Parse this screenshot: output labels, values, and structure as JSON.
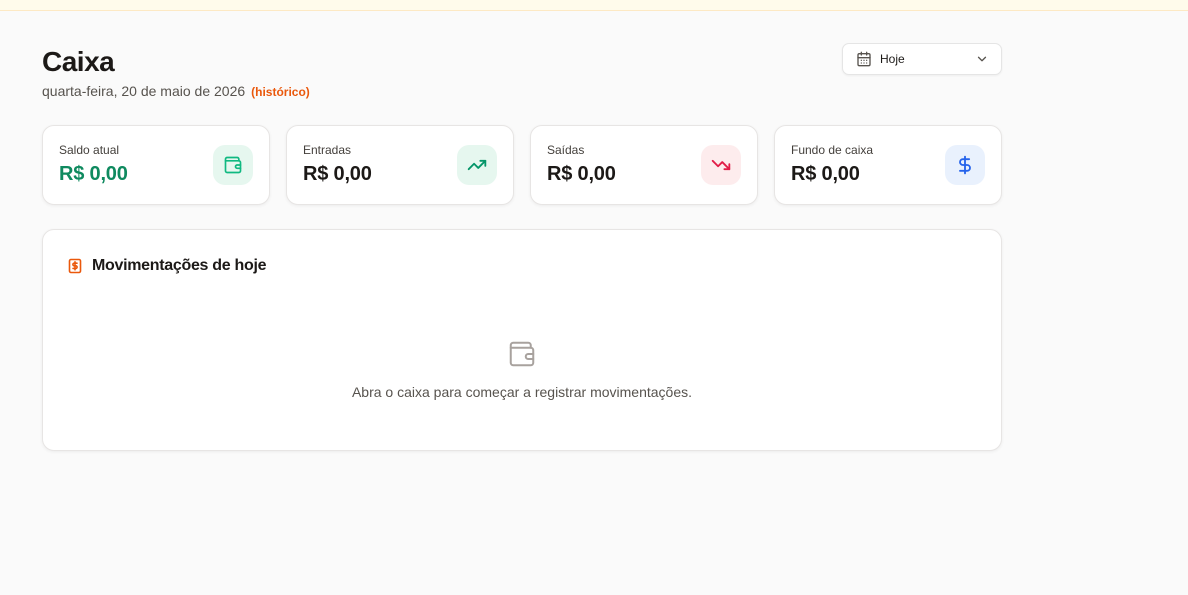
{
  "header": {
    "title": "Caixa",
    "date": "quarta-feira, 20 de maio de 2026",
    "history_link": "(histórico)"
  },
  "period_select": {
    "icon": "calendar-icon",
    "value": "Hoje",
    "chevron": "chevron-down-icon"
  },
  "cards": [
    {
      "label": "Saldo atual",
      "value": "R$ 0,00",
      "icon": "wallet-icon",
      "value_color": "#0f8a5f",
      "icon_color": "#10b981"
    },
    {
      "label": "Entradas",
      "value": "R$ 0,00",
      "icon": "trending-up-icon",
      "icon_color": "#059669"
    },
    {
      "label": "Saídas",
      "value": "R$ 0,00",
      "icon": "trending-down-icon",
      "icon_color": "#e11d48"
    },
    {
      "label": "Fundo de caixa",
      "value": "R$ 0,00",
      "icon": "dollar-sign-icon",
      "icon_color": "#2563eb"
    }
  ],
  "movements": {
    "title": "Movimentações de hoje",
    "title_icon": "receipt-icon",
    "empty_icon": "wallet-icon",
    "empty_message": "Abra o caixa para começar a registrar movimentações."
  },
  "colors": {
    "accent": "#ea580c",
    "background": "#fafafa",
    "banner": "#fffbeb"
  }
}
